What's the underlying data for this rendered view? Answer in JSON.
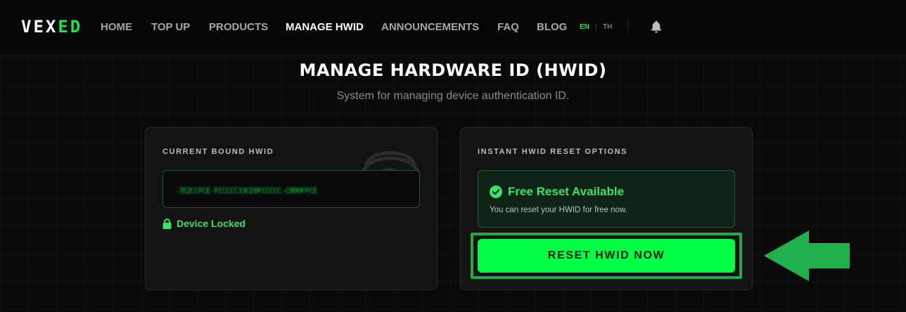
{
  "nav": {
    "logo_main": "VEX",
    "logo_accent": "ED",
    "items": [
      {
        "label": "HOME",
        "active": false
      },
      {
        "label": "TOP UP",
        "active": false
      },
      {
        "label": "PRODUCTS",
        "active": false
      },
      {
        "label": "MANAGE HWID",
        "active": true
      },
      {
        "label": "ANNOUNCEMENTS",
        "active": false
      },
      {
        "label": "FAQ",
        "active": false
      },
      {
        "label": "BLOG",
        "active": false
      }
    ],
    "languages": [
      {
        "label": "EN",
        "active": true
      },
      {
        "label": "TH",
        "active": false
      }
    ],
    "language_separator": "|",
    "notifications_icon": "bell-icon"
  },
  "page": {
    "title": "MANAGE HARDWARE ID (HWID)",
    "subtitle": "System for managing device authentication ID."
  },
  "current_hwid": {
    "heading": "CURRENT BOUND HWID",
    "value": "-7E2CCFCE-FCCCCC33CE0FCCCCC-C000FFCE",
    "status_label": "Device Locked",
    "status_icon": "lock-icon",
    "decor_icon": "fingerprint-icon"
  },
  "reset_options": {
    "heading": "INSTANT HWID RESET OPTIONS",
    "free_title": "Free Reset Available",
    "free_desc": "You can reset your HWID for free now.",
    "free_icon": "check-circle-icon",
    "button_label": "RESET HWID NOW"
  },
  "colors": {
    "accent": "#00ff44",
    "accent_text": "#3fe06c",
    "annotation": "#1fa84a"
  }
}
